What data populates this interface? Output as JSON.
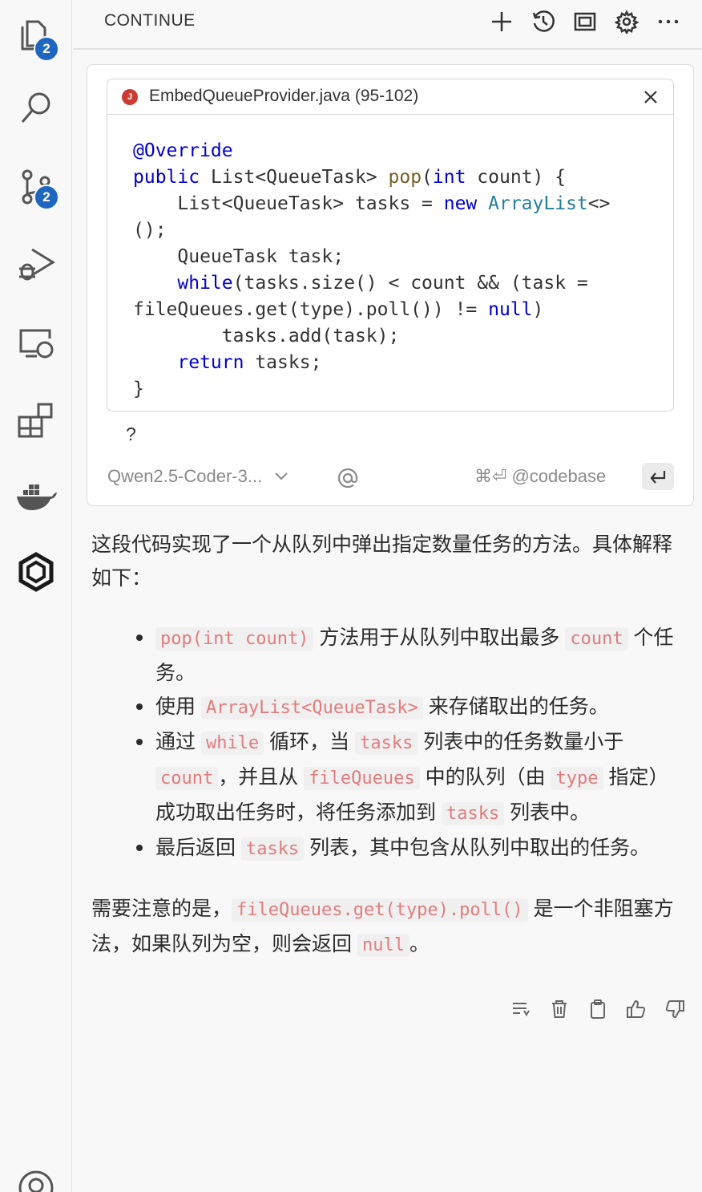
{
  "activity_bar": {
    "explorer_badge": "2",
    "scm_badge": "2"
  },
  "header": {
    "title": "CONTINUE"
  },
  "context": {
    "file_label": "EmbedQueueProvider.java (95-102)",
    "file_icon_letter": "J"
  },
  "code_lines": [
    "@Override",
    "public List<QueueTask> pop(int count) {",
    "    List<QueueTask> tasks = new ArrayList<>",
    "();",
    "    QueueTask task;",
    "    while(tasks.size() < count && (task =",
    "fileQueues.get(type).poll()) != null)",
    "        tasks.add(task);",
    "    return tasks;",
    "}"
  ],
  "input": {
    "question": "?",
    "model": "Qwen2.5-Coder-3...",
    "at_symbol": "@",
    "shortcut": "⌘⏎",
    "codebase_label": "@codebase"
  },
  "response": {
    "intro": "这段代码实现了一个从队列中弹出指定数量任务的方法。具体解释如下：",
    "bullets": [
      {
        "parts": [
          {
            "code": "pop(int count)"
          },
          {
            "text": " 方法用于从队列中取出最多 "
          },
          {
            "code": "count"
          },
          {
            "text": " 个任务。"
          }
        ]
      },
      {
        "parts": [
          {
            "text": "使用 "
          },
          {
            "code": "ArrayList<QueueTask>"
          },
          {
            "text": " 来存储取出的任务。"
          }
        ]
      },
      {
        "parts": [
          {
            "text": "通过 "
          },
          {
            "code": "while"
          },
          {
            "text": " 循环，当 "
          },
          {
            "code": "tasks"
          },
          {
            "text": " 列表中的任务数量小于 "
          },
          {
            "code": "count"
          },
          {
            "text": "，并且从 "
          },
          {
            "code": "fileQueues"
          },
          {
            "text": " 中的队列（由 "
          },
          {
            "code": "type"
          },
          {
            "text": " 指定）成功取出任务时，将任务添加到 "
          },
          {
            "code": "tasks"
          },
          {
            "text": " 列表中。"
          }
        ]
      },
      {
        "parts": [
          {
            "text": "最后返回 "
          },
          {
            "code": "tasks"
          },
          {
            "text": " 列表，其中包含从队列中取出的任务。"
          }
        ]
      }
    ],
    "note_before": "需要注意的是，",
    "note_code": "fileQueues.get(type).poll()",
    "note_middle": " 是一个非阻塞方法，如果队列为空，则会返回 ",
    "note_code2": "null",
    "note_after": "。"
  },
  "colors": {
    "accent": "#1f66c1",
    "inline_code": "#e07c7c",
    "keyword": "#0000cc"
  }
}
